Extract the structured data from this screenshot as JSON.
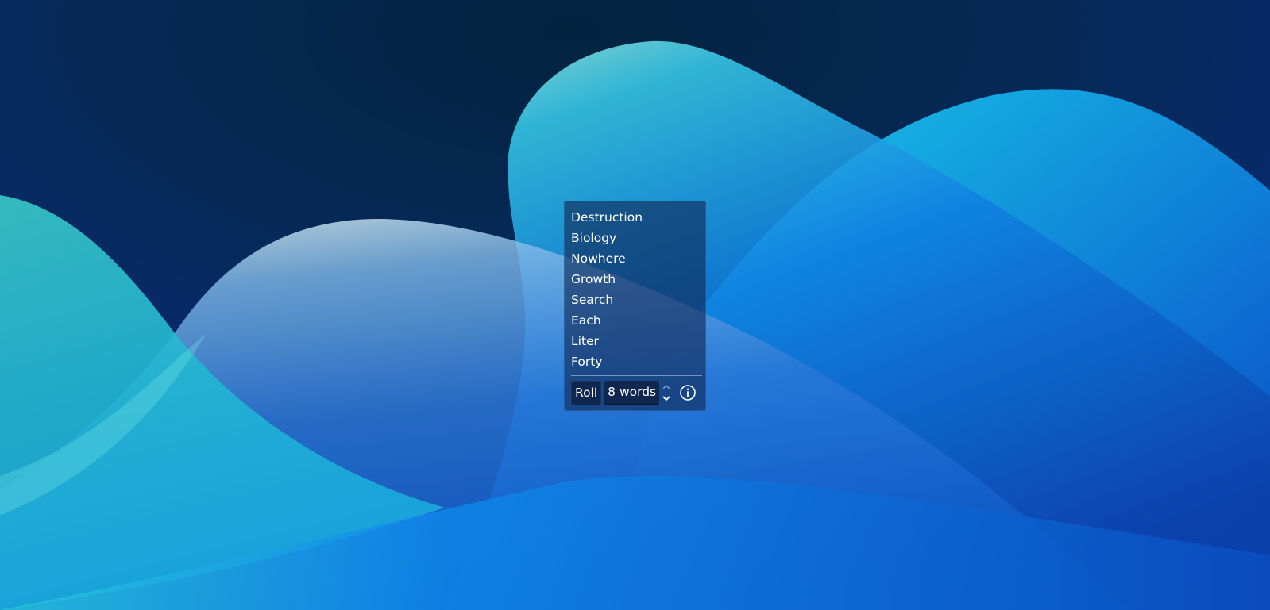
{
  "widget": {
    "words": [
      "Destruction",
      "Biology",
      "Nowhere",
      "Growth",
      "Search",
      "Each",
      "Liter",
      "Forty"
    ],
    "roll_label": "Roll",
    "count_label": "8 words",
    "spin_icon": "spinbox-arrows-icon",
    "info_icon": "info-icon"
  },
  "wallpaper": {
    "colors": {
      "deep_navy": "#04213f",
      "royal_blue": "#0a3aa8",
      "bright_blue": "#0a78f0",
      "cyan": "#1fd2e8",
      "teal": "#2cc6c4"
    }
  }
}
